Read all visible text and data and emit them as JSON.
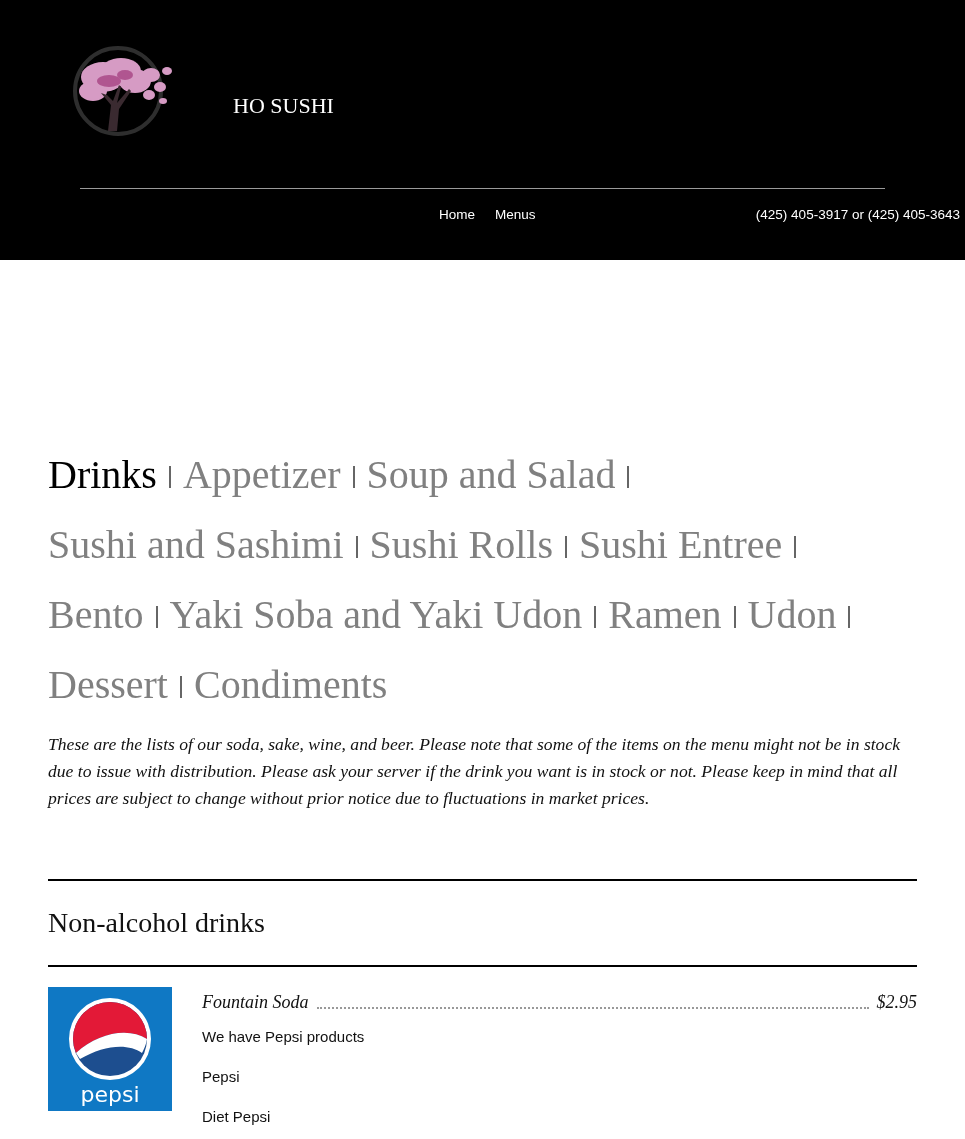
{
  "header": {
    "brand": "HO SUSHI",
    "nav": [
      {
        "label": "Home"
      },
      {
        "label": "Menus"
      }
    ],
    "phone": "(425) 405-3917 or (425) 405-3643"
  },
  "categories": [
    {
      "label": "Drinks",
      "selected": true
    },
    {
      "label": "Appetizer",
      "selected": false
    },
    {
      "label": "Soup and Salad",
      "selected": false
    },
    {
      "label": "Sushi and Sashimi",
      "selected": false
    },
    {
      "label": "Sushi Rolls",
      "selected": false
    },
    {
      "label": "Sushi Entree",
      "selected": false
    },
    {
      "label": "Bento",
      "selected": false
    },
    {
      "label": "Yaki Soba and Yaki Udon",
      "selected": false
    },
    {
      "label": "Ramen",
      "selected": false
    },
    {
      "label": "Udon",
      "selected": false
    },
    {
      "label": "Dessert",
      "selected": false
    },
    {
      "label": "Condiments",
      "selected": false
    }
  ],
  "intro": "These are the lists of our soda, sake, wine, and beer. Please note that some of the items on the menu might not be in stock due to issue with distribution. Please ask your server if the drink you want is in stock or not. Please keep in mind that all prices are subject to change without prior notice due to fluctuations in market prices.",
  "sections": [
    {
      "title": "Non-alcohol drinks",
      "items": [
        {
          "name": "Fountain Soda",
          "price": "$2.95",
          "logo_text": "pepsi",
          "description": "We have Pepsi products",
          "variants": [
            "Pepsi",
            "Diet Pepsi"
          ]
        }
      ]
    }
  ]
}
